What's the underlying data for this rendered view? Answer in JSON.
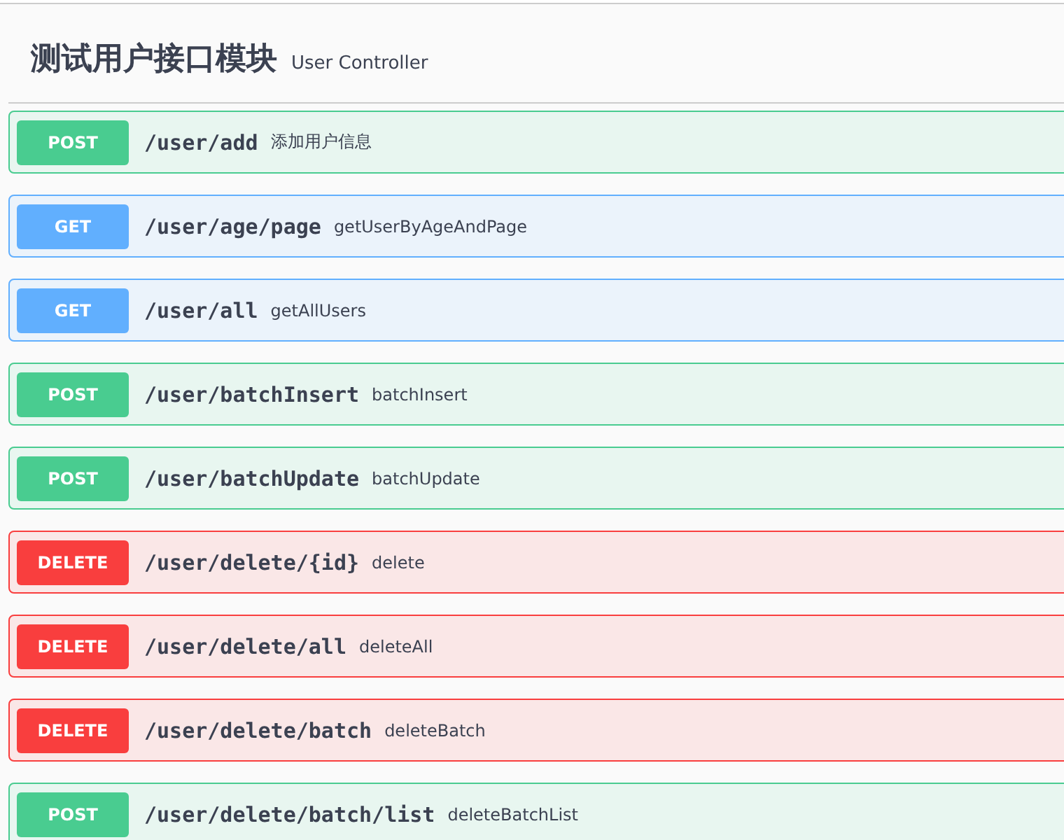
{
  "section": {
    "title": "测试用户接口模块",
    "description": "User Controller"
  },
  "operations": [
    {
      "kind": "post",
      "method": "POST",
      "path": "/user/add",
      "summary": "添加用户信息"
    },
    {
      "kind": "get",
      "method": "GET",
      "path": "/user/age/page",
      "summary": "getUserByAgeAndPage"
    },
    {
      "kind": "get",
      "method": "GET",
      "path": "/user/all",
      "summary": "getAllUsers"
    },
    {
      "kind": "post",
      "method": "POST",
      "path": "/user/batchInsert",
      "summary": "batchInsert"
    },
    {
      "kind": "post",
      "method": "POST",
      "path": "/user/batchUpdate",
      "summary": "batchUpdate"
    },
    {
      "kind": "delete",
      "method": "DELETE",
      "path": "/user/delete/{id}",
      "summary": "delete"
    },
    {
      "kind": "delete",
      "method": "DELETE",
      "path": "/user/delete/all",
      "summary": "deleteAll"
    },
    {
      "kind": "delete",
      "method": "DELETE",
      "path": "/user/delete/batch",
      "summary": "deleteBatch"
    },
    {
      "kind": "post",
      "method": "POST",
      "path": "/user/delete/batch/list",
      "summary": "deleteBatchList"
    }
  ]
}
